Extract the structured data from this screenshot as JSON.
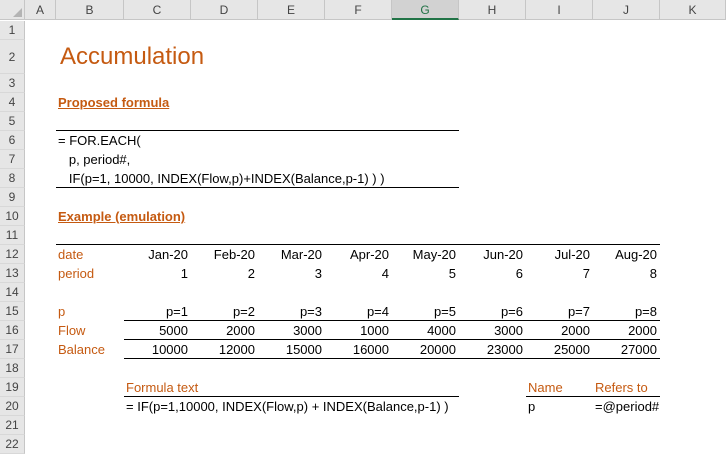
{
  "columns": [
    "A",
    "B",
    "C",
    "D",
    "E",
    "F",
    "G",
    "H",
    "I",
    "J",
    "K"
  ],
  "selected_column": "G",
  "rows": [
    "1",
    "2",
    "3",
    "4",
    "5",
    "6",
    "7",
    "8",
    "9",
    "10",
    "11",
    "12",
    "13",
    "14",
    "15",
    "16",
    "17",
    "18",
    "19",
    "20",
    "21",
    "22"
  ],
  "title": "Accumulation",
  "proposed_label": "Proposed formula",
  "formula_lines": [
    "= FOR.EACH(",
    "   p, period#,",
    "   IF(p=1, 10000, INDEX(Flow,p)+INDEX(Balance,p-1) ) )"
  ],
  "example_label": "Example (emulation)",
  "labels": {
    "date": "date",
    "period": "period",
    "p": "p",
    "flow": "Flow",
    "balance": "Balance"
  },
  "dates": [
    "Jan-20",
    "Feb-20",
    "Mar-20",
    "Apr-20",
    "May-20",
    "Jun-20",
    "Jul-20",
    "Aug-20"
  ],
  "periods": [
    "1",
    "2",
    "3",
    "4",
    "5",
    "6",
    "7",
    "8"
  ],
  "p_values": [
    "p=1",
    "p=2",
    "p=3",
    "p=4",
    "p=5",
    "p=6",
    "p=7",
    "p=8"
  ],
  "flow": [
    "5000",
    "2000",
    "3000",
    "1000",
    "4000",
    "3000",
    "2000",
    "2000"
  ],
  "balance": [
    "10000",
    "12000",
    "15000",
    "16000",
    "20000",
    "23000",
    "25000",
    "27000"
  ],
  "formula_text_label": "Formula text",
  "formula_text": "= IF(p=1,10000, INDEX(Flow,p) + INDEX(Balance,p-1) )",
  "names_table": {
    "name_header": "Name",
    "refers_header": "Refers to",
    "name": "p",
    "refers": "=@period#"
  },
  "colors": {
    "accent": "#c55a11",
    "header_bg": "#e6e6e6",
    "selected_header": "#217346"
  }
}
